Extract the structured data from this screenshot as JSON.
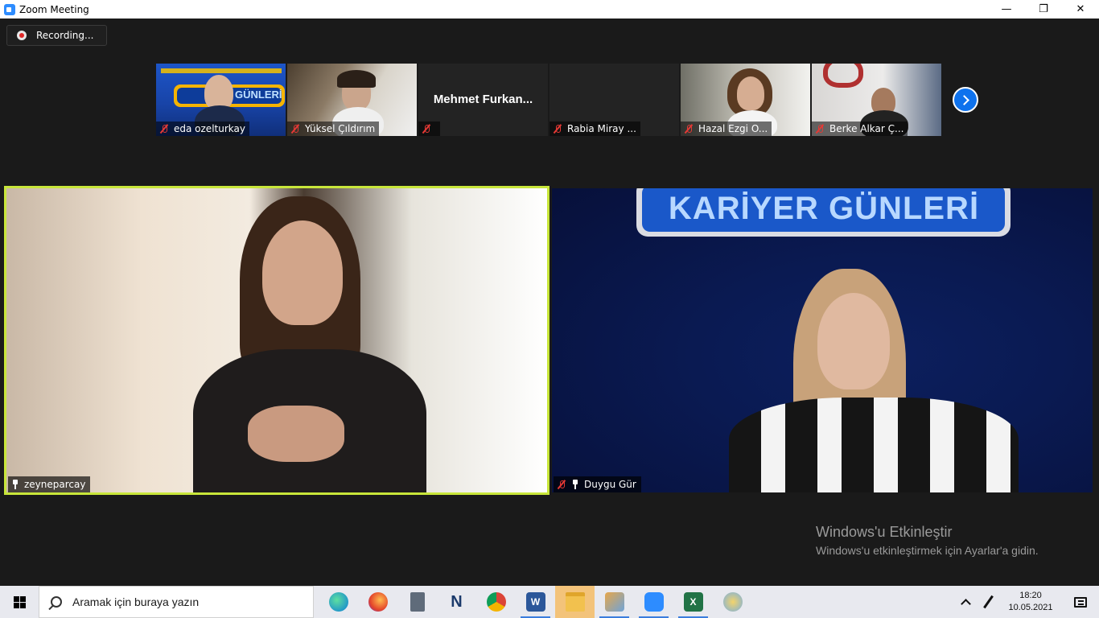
{
  "window": {
    "title": "Zoom Meeting",
    "controls": {
      "minimize": "—",
      "restore": "❐",
      "close": "✕"
    }
  },
  "recording": {
    "label": "Recording..."
  },
  "thumbnails": [
    {
      "name": "eda ozelturkay",
      "muted": true,
      "video": true
    },
    {
      "name": "Yüksel Çıldırım",
      "muted": true,
      "video": true
    },
    {
      "name": "",
      "display_name": "Mehmet  Furkan...",
      "muted": true,
      "video": false
    },
    {
      "name": "Rabia Miray ...",
      "muted": true,
      "video": false
    },
    {
      "name": "Hazal Ezgi O...",
      "muted": true,
      "video": true
    },
    {
      "name": "Berke Alkar Ç...",
      "muted": true,
      "video": true
    }
  ],
  "main_videos": [
    {
      "name": "zeyneparcay",
      "pinned": true,
      "muted": false,
      "active_speaker": true
    },
    {
      "name": "Duygu Gür",
      "pinned": true,
      "muted": true,
      "active_speaker": false,
      "banner": "KARİYER GÜNLERİ"
    }
  ],
  "thumb_banner": "GÜNLERİ",
  "watermark": {
    "line1": "Windows'u Etkinleştir",
    "line2": "Windows'u etkinleştirmek için Ayarlar'a gidin."
  },
  "taskbar": {
    "search_placeholder": "Aramak için buraya yazın",
    "apps": [
      {
        "icon": "edge-icon"
      },
      {
        "icon": "firefox-icon"
      },
      {
        "icon": "calculator-icon"
      },
      {
        "icon": "nx-icon",
        "label": "N"
      },
      {
        "icon": "chrome-icon"
      },
      {
        "icon": "word-icon",
        "label": "W"
      },
      {
        "icon": "file-explorer-icon"
      },
      {
        "icon": "paint-icon"
      },
      {
        "icon": "zoom-icon"
      },
      {
        "icon": "excel-icon",
        "label": "X"
      },
      {
        "icon": "paint-brush-icon"
      }
    ],
    "clock": {
      "time": "18:20",
      "date": "10.05.2021"
    }
  }
}
